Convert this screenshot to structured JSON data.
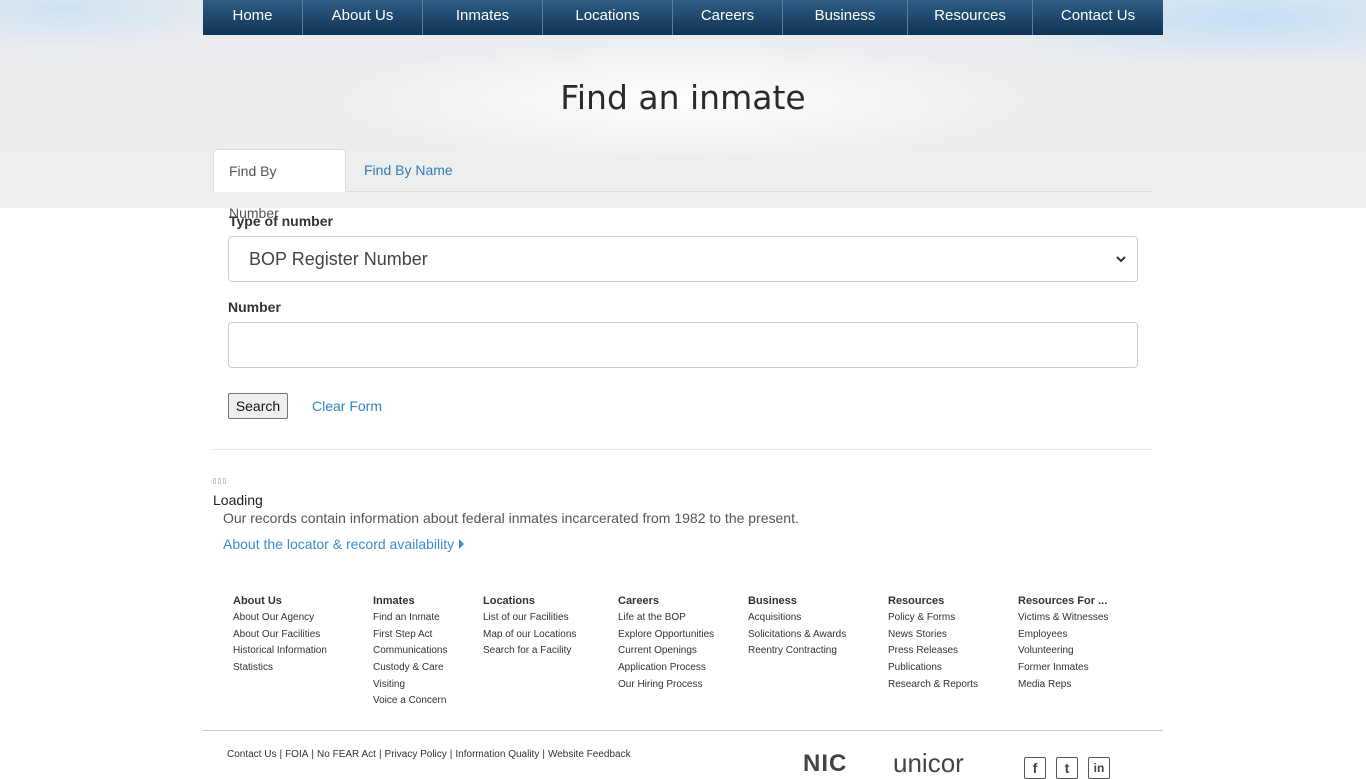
{
  "nav": {
    "items": [
      {
        "label": "Home"
      },
      {
        "label": "About Us"
      },
      {
        "label": "Inmates"
      },
      {
        "label": "Locations"
      },
      {
        "label": "Careers"
      },
      {
        "label": "Business"
      },
      {
        "label": "Resources"
      },
      {
        "label": "Contact Us"
      }
    ]
  },
  "page": {
    "title": "Find an inmate"
  },
  "tabs": [
    {
      "label": "Find By Number",
      "active": true
    },
    {
      "label": "Find By Name",
      "active": false
    }
  ],
  "form": {
    "type_label": "Type of number",
    "type_selected": "BOP Register Number",
    "number_label": "Number",
    "number_value": "",
    "search_label": "Search",
    "clear_label": "Clear Form"
  },
  "status": {
    "loading": "Loading",
    "records_note": "Our records contain information about federal inmates incarcerated from 1982 to the present.",
    "about_link": "About the locator & record availability"
  },
  "footer": {
    "columns": [
      {
        "heading": "About Us",
        "links": [
          "About Our Agency",
          "About Our Facilities",
          "Historical Information",
          "Statistics"
        ]
      },
      {
        "heading": "Inmates",
        "links": [
          "Find an Inmate",
          "First Step Act",
          "Communications",
          "Custody & Care",
          "Visiting",
          "Voice a Concern"
        ]
      },
      {
        "heading": "Locations",
        "links": [
          "List of our Facilities",
          "Map of our Locations",
          "Search for a Facility"
        ]
      },
      {
        "heading": "Careers",
        "links": [
          "Life at the BOP",
          "Explore Opportunities",
          "Current Openings",
          "Application Process",
          "Our Hiring Process"
        ]
      },
      {
        "heading": "Business",
        "links": [
          "Acquisitions",
          "Solicitations & Awards",
          "Reentry Contracting"
        ]
      },
      {
        "heading": "Resources",
        "links": [
          "Policy & Forms",
          "News Stories",
          "Press Releases",
          "Publications",
          "Research & Reports"
        ]
      },
      {
        "heading": "Resources For ...",
        "links": [
          "Victims & Witnesses",
          "Employees",
          "Volunteering",
          "Former Inmates",
          "Media Reps"
        ]
      }
    ],
    "legal": [
      "Contact Us",
      "FOIA",
      "No FEAR Act",
      "Privacy Policy",
      "Information Quality",
      "Website Feedback"
    ],
    "logos": {
      "nic": "NIC",
      "unicor": "unicor"
    },
    "social": {
      "facebook": "f",
      "twitter": "t",
      "linkedin": "in"
    }
  },
  "colors": {
    "nav_top": "#2f5d85",
    "nav_bottom": "#0f3354",
    "link": "#337ab7"
  }
}
